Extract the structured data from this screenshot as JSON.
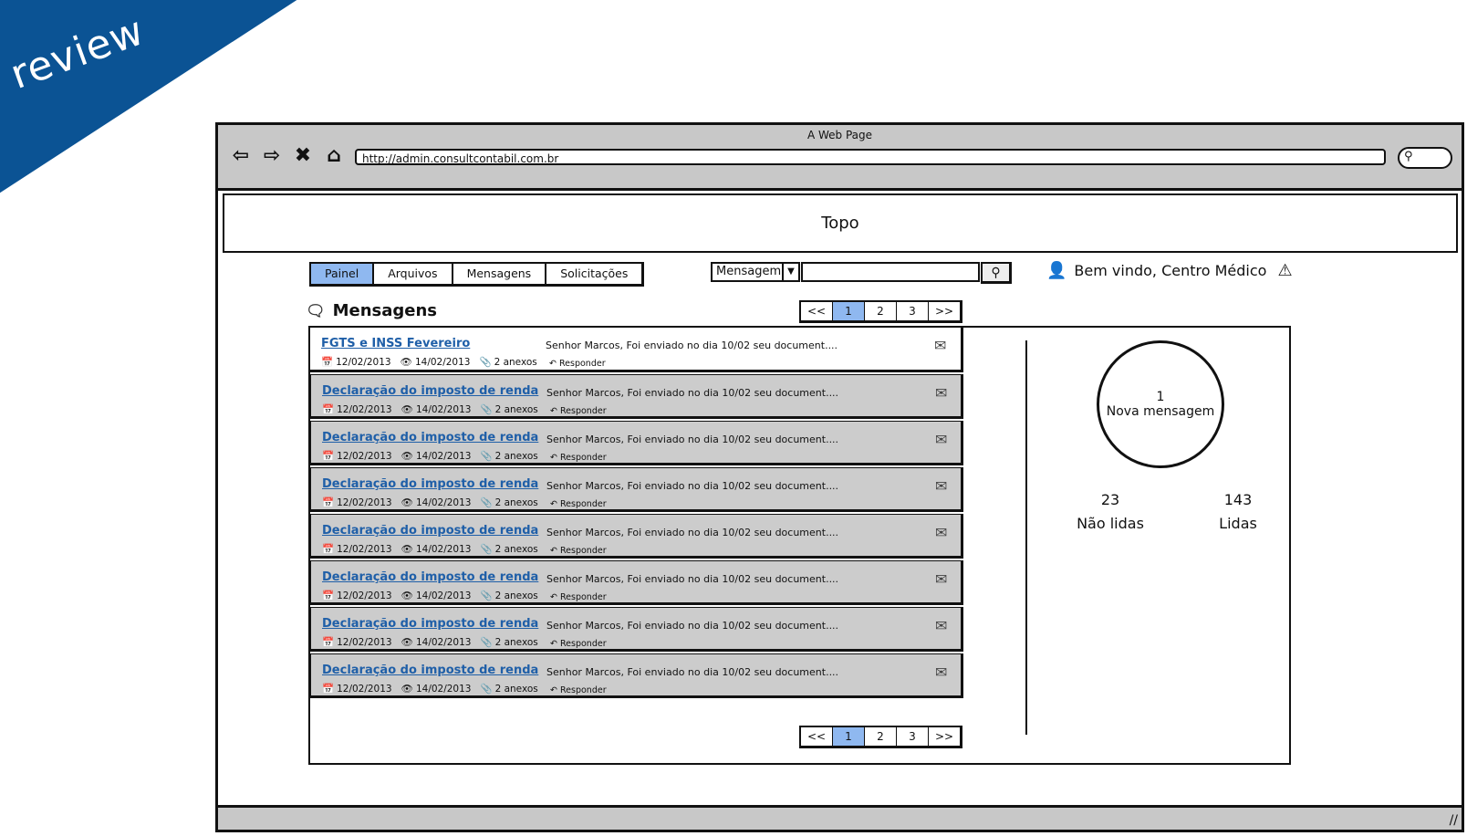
{
  "ribbon": {
    "label": "review"
  },
  "browser": {
    "title": "A Web Page",
    "url": "http://admin.consultcontabil.com.br",
    "nav_icons": [
      "back-icon",
      "forward-icon",
      "close-icon",
      "home-icon"
    ]
  },
  "header": {
    "banner": "Topo"
  },
  "tabs": [
    {
      "label": "Painel",
      "active": true
    },
    {
      "label": "Arquivos",
      "active": false
    },
    {
      "label": "Mensagens",
      "active": false
    },
    {
      "label": "Solicitações",
      "active": false
    }
  ],
  "search": {
    "type_selected": "Mensagem",
    "query": ""
  },
  "user": {
    "welcome": "Bem vindo, Centro Médico"
  },
  "section": {
    "title": "Mensagens"
  },
  "pagination": {
    "prev": "<<",
    "pages": [
      "1",
      "2",
      "3"
    ],
    "next": ">>",
    "current": "1"
  },
  "messages": [
    {
      "subject": "FGTS e INSS Fevereiro",
      "date": "12/02/2013",
      "viewed": "14/02/2013",
      "attachments": "2 anexos",
      "preview": "Senhor Marcos, Foi enviado no dia 10/02 seu document....",
      "reply": "Responder",
      "read": false
    },
    {
      "subject": "Declaração do imposto de renda",
      "date": "12/02/2013",
      "viewed": "14/02/2013",
      "attachments": "2 anexos",
      "preview": "Senhor Marcos, Foi enviado no dia 10/02 seu document....",
      "reply": "Responder",
      "read": true
    },
    {
      "subject": "Declaração do imposto de renda",
      "date": "12/02/2013",
      "viewed": "14/02/2013",
      "attachments": "2 anexos",
      "preview": "Senhor Marcos, Foi enviado no dia 10/02 seu document....",
      "reply": "Responder",
      "read": true
    },
    {
      "subject": "Declaração do imposto de renda",
      "date": "12/02/2013",
      "viewed": "14/02/2013",
      "attachments": "2 anexos",
      "preview": "Senhor Marcos, Foi enviado no dia 10/02 seu document....",
      "reply": "Responder",
      "read": true
    },
    {
      "subject": "Declaração do imposto de renda",
      "date": "12/02/2013",
      "viewed": "14/02/2013",
      "attachments": "2 anexos",
      "preview": "Senhor Marcos, Foi enviado no dia 10/02 seu document....",
      "reply": "Responder",
      "read": true
    },
    {
      "subject": "Declaração do imposto de renda",
      "date": "12/02/2013",
      "viewed": "14/02/2013",
      "attachments": "2 anexos",
      "preview": "Senhor Marcos, Foi enviado no dia 10/02 seu document....",
      "reply": "Responder",
      "read": true
    },
    {
      "subject": "Declaração do imposto de renda",
      "date": "12/02/2013",
      "viewed": "14/02/2013",
      "attachments": "2 anexos",
      "preview": "Senhor Marcos, Foi enviado no dia 10/02 seu document....",
      "reply": "Responder",
      "read": true
    },
    {
      "subject": "Declaração do imposto de renda",
      "date": "12/02/2013",
      "viewed": "14/02/2013",
      "attachments": "2 anexos",
      "preview": "Senhor Marcos, Foi enviado no dia 10/02 seu document....",
      "reply": "Responder",
      "read": true
    }
  ],
  "stats": {
    "new_count": "1",
    "new_label": "Nova mensagem",
    "unread_count": "23",
    "unread_label": "Não lidas",
    "read_count": "143",
    "read_label": "Lidas"
  },
  "colors": {
    "ribbon": "#0b5394",
    "active_tab": "#8fb8f0",
    "link": "#1f5fa8",
    "row_read": "#cccccc"
  }
}
